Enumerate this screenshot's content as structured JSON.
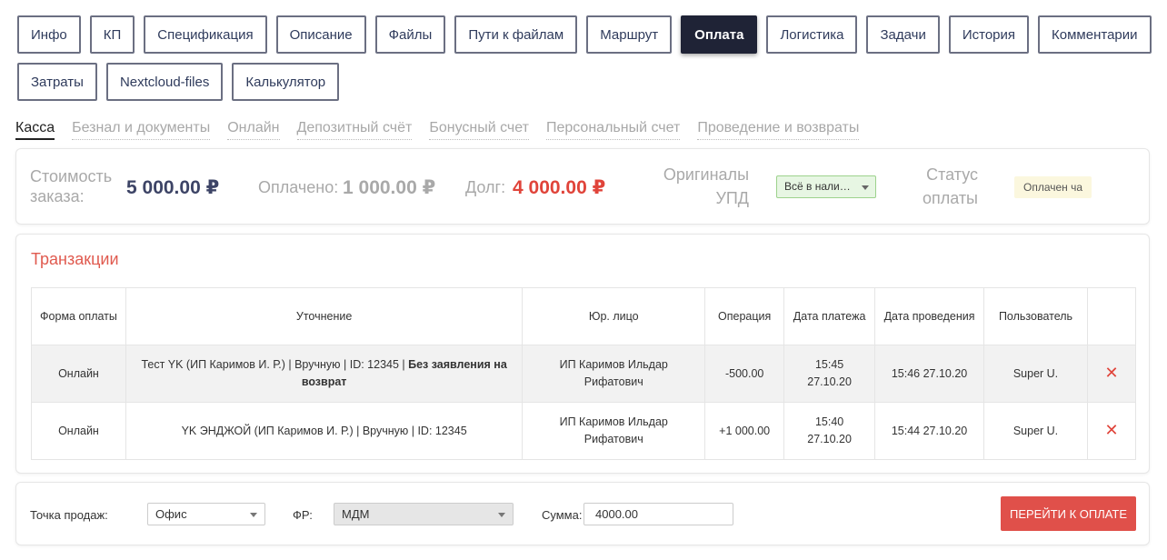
{
  "tabs": {
    "row1": [
      "Инфо",
      "КП",
      "Спецификация",
      "Описание",
      "Файлы",
      "Пути к файлам",
      "Маршрут",
      "Оплата",
      "Логистика",
      "Задачи",
      "История",
      "Комментарии"
    ],
    "row2": [
      "Затраты",
      "Nextcloud-files",
      "Калькулятор"
    ],
    "active": "Оплата"
  },
  "subtabs": [
    "Касса",
    "Безнал и документы",
    "Онлайн",
    "Депозитный счёт",
    "Бонусный счет",
    "Персональный счет",
    "Проведение и возвраты"
  ],
  "summary": {
    "cost_label_1": "Стоимость",
    "cost_label_2": "заказа:",
    "cost_value": "5 000.00 ₽",
    "paid_label": "Оплачено:",
    "paid_value": "1 000.00 ₽",
    "debt_label": "Долг:",
    "debt_value": "4 000.00 ₽",
    "originals_label_1": "Оригиналы",
    "originals_label_2": "УПД",
    "originals_select": "Всё в нали…",
    "status_label_1": "Статус",
    "status_label_2": "оплаты",
    "status_badge": "Оплачен ча",
    "colors": {
      "cost": "#3d4466",
      "paid": "#a9a9a9",
      "debt": "#e0443a"
    }
  },
  "transactions": {
    "title": "Транзакции",
    "headers": [
      "Форма оплаты",
      "Уточнение",
      "Юр. лицо",
      "Операция",
      "Дата платежа",
      "Дата проведения",
      "Пользователь",
      ""
    ],
    "rows": [
      {
        "form": "Онлайн",
        "detail": "Тест YK (ИП Каримов И. Р.) | Вручную | ID: 12345 | ",
        "detail_bold": "Без заявления на возврат",
        "entity": "ИП Каримов Ильдар Рифатович",
        "operation": "-500.00",
        "pay_time": "15:45",
        "pay_date": "27.10.20",
        "posted": "15:46 27.10.20",
        "user": "Super U."
      },
      {
        "form": "Онлайн",
        "detail": "YK ЭНДЖОЙ (ИП Каримов И. Р.) | Вручную | ID: 12345",
        "detail_bold": "",
        "entity": "ИП Каримов Ильдар Рифатович",
        "operation": "+1 000.00",
        "pay_time": "15:40",
        "pay_date": "27.10.20",
        "posted": "15:44 27.10.20",
        "user": "Super U."
      }
    ]
  },
  "bottom": {
    "pos_label": "Точка продаж:",
    "pos_value": "Офис",
    "fr_label": "ФР:",
    "fr_value": "МДМ",
    "sum_label": "Сумма:",
    "sum_value": "4000.00",
    "pay_button": "ПЕРЕЙТИ К ОПЛАТЕ"
  }
}
